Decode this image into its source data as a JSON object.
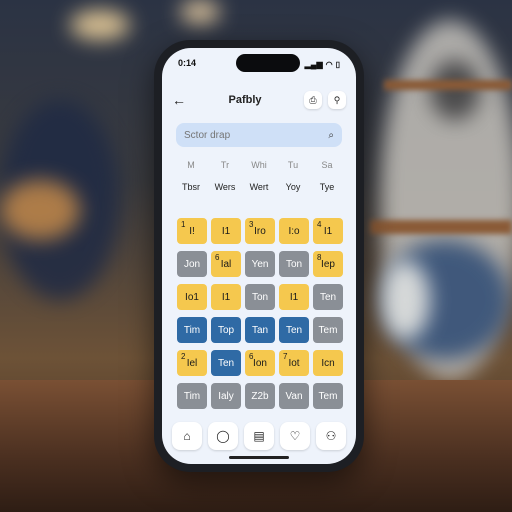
{
  "status": {
    "time": "0:14",
    "battery": "▯"
  },
  "header": {
    "back_icon": "←",
    "title": "Pafbly",
    "share_icon": "⎙",
    "profile_icon": "⚲"
  },
  "search": {
    "placeholder": "Sctor drap",
    "icon": "⌕"
  },
  "weekdays_top": [
    "M",
    "Tr",
    "Whi",
    "Tu",
    "Sa"
  ],
  "weekdays_bottom": [
    "Tbsr",
    "Wers",
    "Wert",
    "Yoy",
    "Tye"
  ],
  "grid": [
    {
      "num": "1",
      "text": "I!",
      "color": "y"
    },
    {
      "num": "",
      "text": "I1",
      "color": "y"
    },
    {
      "num": "3",
      "text": "Iro",
      "color": "y"
    },
    {
      "num": "",
      "text": "I:o",
      "color": "y"
    },
    {
      "num": "4",
      "text": "I1",
      "color": "y"
    },
    {
      "num": "",
      "text": "Jon",
      "color": "g"
    },
    {
      "num": "6",
      "text": "Ial",
      "color": "y"
    },
    {
      "num": "",
      "text": "Yen",
      "color": "g"
    },
    {
      "num": "",
      "text": "Ton",
      "color": "g"
    },
    {
      "num": "8",
      "text": "Iep",
      "color": "y"
    },
    {
      "num": "",
      "text": "Io1",
      "color": "y"
    },
    {
      "num": "",
      "text": "I1",
      "color": "y"
    },
    {
      "num": "",
      "text": "Ton",
      "color": "g"
    },
    {
      "num": "",
      "text": "I1",
      "color": "y"
    },
    {
      "num": "",
      "text": "Ten",
      "color": "g"
    },
    {
      "num": "",
      "text": "Tim",
      "color": "b"
    },
    {
      "num": "",
      "text": "Top",
      "color": "b"
    },
    {
      "num": "",
      "text": "Tan",
      "color": "b"
    },
    {
      "num": "",
      "text": "Ten",
      "color": "b"
    },
    {
      "num": "",
      "text": "Tem",
      "color": "g"
    },
    {
      "num": "2",
      "text": "Iel",
      "color": "y"
    },
    {
      "num": "",
      "text": "Ten",
      "color": "b"
    },
    {
      "num": "6",
      "text": "Ion",
      "color": "y"
    },
    {
      "num": "7",
      "text": "Iot",
      "color": "y"
    },
    {
      "num": "",
      "text": "Icn",
      "color": "y"
    },
    {
      "num": "",
      "text": "Tim",
      "color": "g"
    },
    {
      "num": "",
      "text": "Ialy",
      "color": "g"
    },
    {
      "num": "",
      "text": "Z2b",
      "color": "g"
    },
    {
      "num": "",
      "text": "Van",
      "color": "g"
    },
    {
      "num": "",
      "text": "Tem",
      "color": "g"
    }
  ],
  "tabs": [
    {
      "name": "home-icon",
      "glyph": "⌂"
    },
    {
      "name": "chat-icon",
      "glyph": "◯"
    },
    {
      "name": "calendar-icon",
      "glyph": "▤"
    },
    {
      "name": "heart-icon",
      "glyph": "♡"
    },
    {
      "name": "profile-icon",
      "glyph": "⚇"
    }
  ],
  "colors": {
    "yellow": "#f5c84e",
    "gray": "#8a8f96",
    "blue": "#2f6aa5",
    "screen": "#eef3fb"
  }
}
